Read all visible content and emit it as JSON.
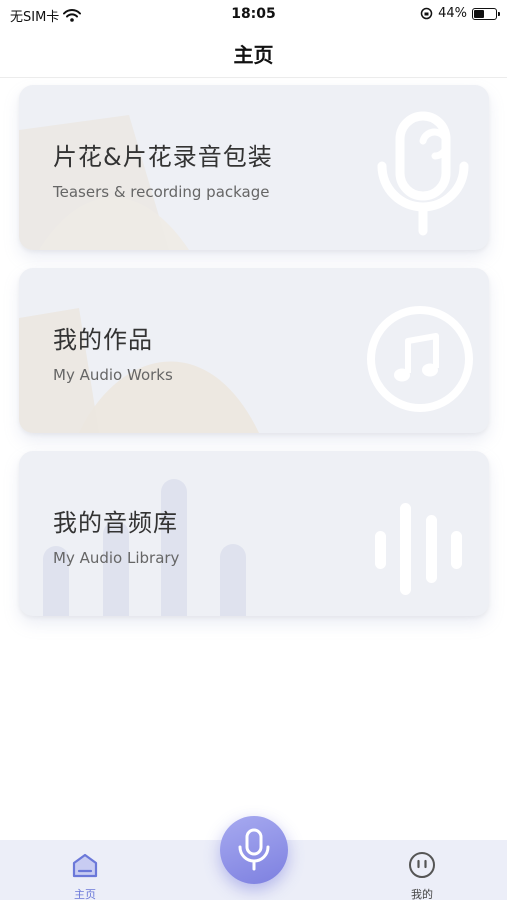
{
  "status_bar": {
    "carrier": "无SIM卡",
    "time": "18:05",
    "battery": "44%",
    "battery_level": 0.44
  },
  "nav": {
    "title": "主页"
  },
  "cards": [
    {
      "title": "片花&片花录音包装",
      "subtitle": "Teasers & recording package",
      "icon": "microphone-icon"
    },
    {
      "title": "我的作品",
      "subtitle": "My Audio Works",
      "icon": "music-note-icon"
    },
    {
      "title": "我的音频库",
      "subtitle": "My Audio Library",
      "icon": "waveform-icon"
    }
  ],
  "tabbar": {
    "home_label": "主页",
    "me_label": "我的",
    "active_color": "#6b78d9",
    "inactive_color": "#444444",
    "center_icon": "microphone-icon"
  }
}
